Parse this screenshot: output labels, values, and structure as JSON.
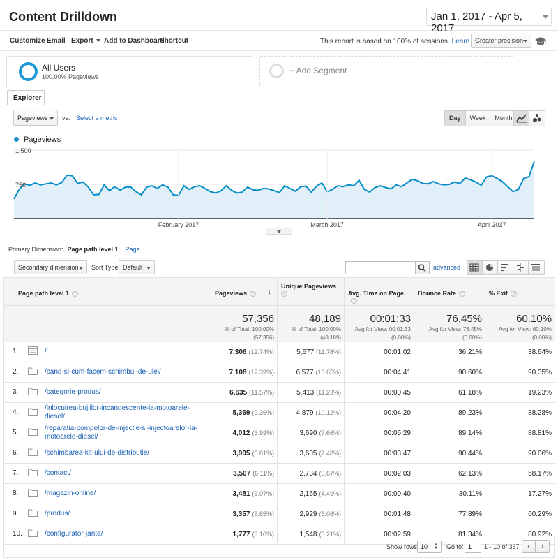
{
  "header": {
    "title": "Content Drilldown",
    "date_range": "Jan 1, 2017 - Apr 5, 2017"
  },
  "toolbar": {
    "customize": "Customize",
    "email": "Email",
    "export": "Export",
    "add_to_dashboard": "Add to Dashboard",
    "shortcut": "Shortcut",
    "sessions_note": "This report is based on 100% of sessions.",
    "learn_more": "Learn more",
    "precision": "Greater precision"
  },
  "segments": {
    "all_users": "All Users",
    "all_users_sub": "100.00% Pageviews",
    "add_segment": "+ Add Segment"
  },
  "explorer": {
    "tab": "Explorer",
    "metric": "Pageviews",
    "vs": "vs.",
    "select_metric": "Select a metric",
    "day": "Day",
    "week": "Week",
    "month": "Month",
    "legend": "Pageviews"
  },
  "chart_data": {
    "type": "area",
    "series": [
      {
        "name": "Pageviews",
        "values": [
          430,
          640,
          760,
          730,
          780,
          740,
          760,
          780,
          740,
          790,
          950,
          940,
          770,
          800,
          690,
          520,
          530,
          740,
          610,
          700,
          620,
          690,
          690,
          590,
          520,
          690,
          720,
          660,
          740,
          690,
          520,
          510,
          720,
          640,
          700,
          720,
          660,
          590,
          560,
          610,
          720,
          620,
          560,
          580,
          690,
          630,
          620,
          660,
          650,
          610,
          570,
          720,
          660,
          600,
          700,
          710,
          580,
          710,
          780,
          590,
          640,
          720,
          700,
          740,
          720,
          840,
          640,
          580,
          680,
          720,
          680,
          650,
          740,
          700,
          780,
          860,
          830,
          770,
          760,
          810,
          760,
          740,
          750,
          800,
          770,
          890,
          850,
          800,
          730,
          910,
          940,
          880,
          810,
          700,
          590,
          640,
          880,
          920,
          1250
        ]
      }
    ],
    "ylim": [
      0,
      1500
    ],
    "yticks": [
      "1,500",
      "750"
    ],
    "xticks": [
      {
        "label": "February 2017",
        "index": 31
      },
      {
        "label": "March 2017",
        "index": 59
      },
      {
        "label": "April 2017",
        "index": 90
      }
    ],
    "colors": {
      "line": "#058dc7",
      "fill": "#e1eff8"
    }
  },
  "dimension": {
    "label": "Primary Dimension:",
    "active": "Page path level 1",
    "other": "Page"
  },
  "controls": {
    "secondary_dimension": "Secondary dimension",
    "sort_type_label": "Sort Type:",
    "sort_type": "Default",
    "advanced": "advanced"
  },
  "table": {
    "headers": {
      "page": "Page path level 1",
      "pageviews": "Pageviews",
      "unique": "Unique Pageviews",
      "avg_time": "Avg. Time on Page",
      "bounce": "Bounce Rate",
      "exit": "% Exit"
    },
    "totals": {
      "pageviews": "57,356",
      "pageviews_sub1": "% of Total: 100.00%",
      "pageviews_sub2": "(57,356)",
      "unique": "48,189",
      "unique_sub1": "% of Total: 100.00%",
      "unique_sub2": "(48,189)",
      "avg_time": "00:01:33",
      "avg_time_sub1": "Avg for View: 00:01:33",
      "avg_time_sub2": "(0.00%)",
      "bounce": "76.45%",
      "bounce_sub1": "Avg for View: 76.45%",
      "bounce_sub2": "(0.00%)",
      "exit": "60.10%",
      "exit_sub1": "Avg for View: 60.10%",
      "exit_sub2": "(0.00%)"
    },
    "rows": [
      {
        "idx": "1.",
        "icon": "page-icon",
        "page": "/",
        "pv": "7,306",
        "pv_pct": "(12.74%)",
        "upv": "5,677",
        "upv_pct": "(11.78%)",
        "time": "00:01:02",
        "bounce": "36.21%",
        "exit": "38.64%"
      },
      {
        "idx": "2.",
        "icon": "folder-icon",
        "page": "/cand-si-cum-facem-schimbul-de-ulei/",
        "pv": "7,108",
        "pv_pct": "(12.39%)",
        "upv": "6,577",
        "upv_pct": "(13.65%)",
        "time": "00:04:41",
        "bounce": "90.60%",
        "exit": "90.35%"
      },
      {
        "idx": "3.",
        "icon": "folder-icon",
        "page": "/categorie-produs/",
        "pv": "6,635",
        "pv_pct": "(11.57%)",
        "upv": "5,413",
        "upv_pct": "(11.23%)",
        "time": "00:00:45",
        "bounce": "61.18%",
        "exit": "19.23%"
      },
      {
        "idx": "4.",
        "icon": "folder-icon",
        "page": "/inlocuirea-bujiilor-incandescente-la-motoarele-diesel/",
        "pv": "5,369",
        "pv_pct": "(9.36%)",
        "upv": "4,879",
        "upv_pct": "(10.12%)",
        "time": "00:04:20",
        "bounce": "89.23%",
        "exit": "88.28%"
      },
      {
        "idx": "5.",
        "icon": "folder-icon",
        "page": "/reparatia-pompelor-de-injectie-si-injectoarelor-la-motoarele-diesel/",
        "pv": "4,012",
        "pv_pct": "(6.99%)",
        "upv": "3,690",
        "upv_pct": "(7.66%)",
        "time": "00:05:29",
        "bounce": "89.14%",
        "exit": "88.81%"
      },
      {
        "idx": "6.",
        "icon": "folder-icon",
        "page": "/schimbarea-kit-ului-de-distributie/",
        "pv": "3,905",
        "pv_pct": "(6.81%)",
        "upv": "3,605",
        "upv_pct": "(7.48%)",
        "time": "00:03:47",
        "bounce": "90.44%",
        "exit": "90.06%"
      },
      {
        "idx": "7.",
        "icon": "folder-icon",
        "page": "/contact/",
        "pv": "3,507",
        "pv_pct": "(6.11%)",
        "upv": "2,734",
        "upv_pct": "(5.67%)",
        "time": "00:02:03",
        "bounce": "62.13%",
        "exit": "58.17%"
      },
      {
        "idx": "8.",
        "icon": "folder-icon",
        "page": "/magazin-online/",
        "pv": "3,481",
        "pv_pct": "(6.07%)",
        "upv": "2,165",
        "upv_pct": "(4.49%)",
        "time": "00:00:40",
        "bounce": "30.11%",
        "exit": "17.27%"
      },
      {
        "idx": "9.",
        "icon": "folder-icon",
        "page": "/produs/",
        "pv": "3,357",
        "pv_pct": "(5.85%)",
        "upv": "2,929",
        "upv_pct": "(6.08%)",
        "time": "00:01:48",
        "bounce": "77.89%",
        "exit": "60.29%"
      },
      {
        "idx": "10.",
        "icon": "folder-icon",
        "page": "/configurator-jante/",
        "pv": "1,777",
        "pv_pct": "(3.10%)",
        "upv": "1,548",
        "upv_pct": "(3.21%)",
        "time": "00:02:59",
        "bounce": "81.34%",
        "exit": "80.92%"
      }
    ]
  },
  "footer": {
    "show_rows": "Show rows:",
    "rows_value": "10",
    "goto": "Go to:",
    "goto_value": "1",
    "range": "1 - 10 of 367"
  }
}
